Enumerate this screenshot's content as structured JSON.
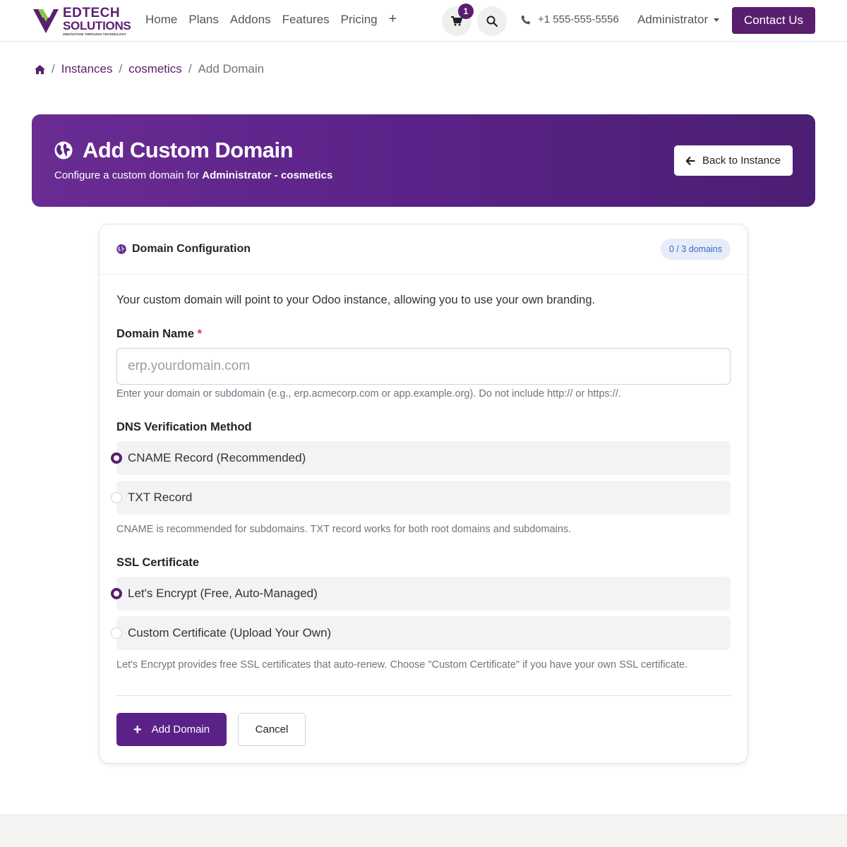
{
  "brand": {
    "logo_line1": "EDTECH",
    "logo_line2": "SOLUTIONS",
    "tagline": "INNOVATION THROUGH TECHNOLOGY",
    "primary_color": "#5a1e6e"
  },
  "nav": {
    "items": [
      "Home",
      "Plans",
      "Addons",
      "Features",
      "Pricing"
    ],
    "more_icon": "plus-icon",
    "cart_count": "1",
    "phone": "+1 555-555-5556",
    "user": "Administrator",
    "contact_label": "Contact Us"
  },
  "breadcrumb": {
    "home_icon": "home-icon",
    "items": [
      "Instances",
      "cosmetics"
    ],
    "current": "Add Domain"
  },
  "hero": {
    "title": "Add Custom Domain",
    "subtitle_prefix": "Configure a custom domain for",
    "subtitle_target": "Administrator - cosmetics",
    "back_label": "Back to Instance"
  },
  "card": {
    "title": "Domain Configuration",
    "count": "0 / 3 domains",
    "intro": "Your custom domain will point to your Odoo instance, allowing you to use your own branding.",
    "domain": {
      "label": "Domain Name",
      "required_mark": "*",
      "placeholder": "erp.yourdomain.com",
      "value": "",
      "help": "Enter your domain or subdomain (e.g., erp.acmecorp.com or app.example.org). Do not include http:// or https://."
    },
    "dns": {
      "label": "DNS Verification Method",
      "options": [
        "CNAME Record (Recommended)",
        "TXT Record"
      ],
      "selected": "CNAME Record (Recommended)",
      "help": "CNAME is recommended for subdomains. TXT record works for both root domains and subdomains."
    },
    "ssl": {
      "label": "SSL Certificate",
      "options": [
        "Let's Encrypt (Free, Auto-Managed)",
        "Custom Certificate (Upload Your Own)"
      ],
      "selected": "Let's Encrypt (Free, Auto-Managed)",
      "help": "Let's Encrypt provides free SSL certificates that auto-renew. Choose \"Custom Certificate\" if you have your own SSL certificate."
    },
    "submit_label": "Add Domain",
    "cancel_label": "Cancel"
  }
}
